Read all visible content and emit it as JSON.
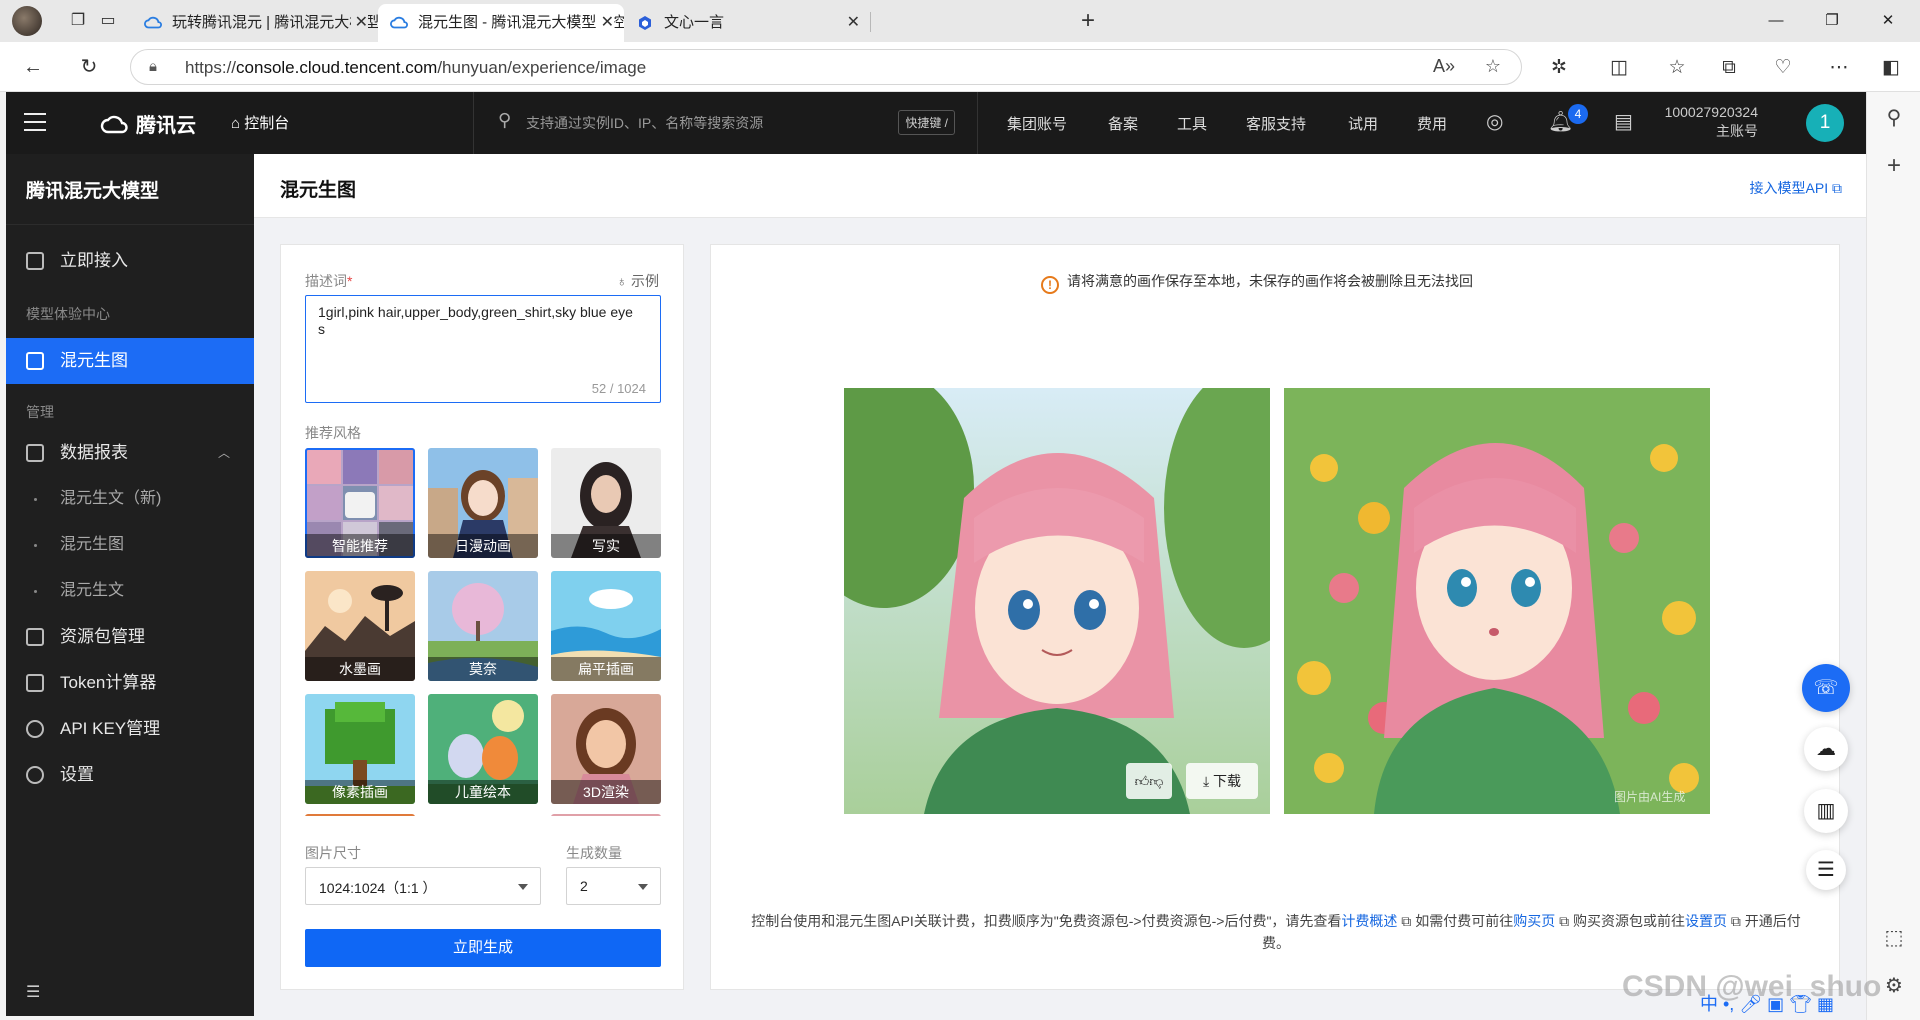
{
  "browser": {
    "tabs": [
      {
        "title": "玩转腾讯混元 | 腾讯混元大模型AI",
        "active": false
      },
      {
        "title": "混元生图 - 腾讯混元大模型 - 控制",
        "active": true
      },
      {
        "title": "文心一言",
        "active": false
      }
    ],
    "url_prefix": "https://",
    "url_domain": "console.cloud.tencent.com",
    "url_path": "/hunyuan/experience/image"
  },
  "topbar": {
    "brand": "腾讯云",
    "console": "控制台",
    "search_placeholder": "支持通过实例ID、IP、名称等搜索资源",
    "shortcut": "快捷键 /",
    "nav": [
      "集团账号",
      "备案",
      "工具",
      "客服支持",
      "试用",
      "费用"
    ],
    "notification_count": "4",
    "account_id": "100027920324",
    "account_role": "主账号",
    "avatar_initial": "1"
  },
  "sidebar": {
    "product": "腾讯混元大模型",
    "quick_access": "立即接入",
    "group_experience": "模型体验中心",
    "image_gen": "混元生图",
    "group_manage": "管理",
    "data_report": "数据报表",
    "sub_items": [
      "混元生文（新)",
      "混元生图",
      "混元生文"
    ],
    "resource_pkg": "资源包管理",
    "token_calc": "Token计算器",
    "api_key": "API KEY管理",
    "settings": "设置"
  },
  "page": {
    "title": "混元生图",
    "api_link": "接入模型API"
  },
  "form": {
    "prompt_label": "描述词",
    "required_mark": "*",
    "example_label": "示例",
    "prompt_value": "1girl,pink hair,upper_body,green_shirt,sky blue eyes",
    "char_count": "52 / 1024",
    "style_label": "推荐风格",
    "styles": [
      "智能推荐",
      "日漫动画",
      "写实",
      "水墨画",
      "莫奈",
      "扁平插画",
      "像素插画",
      "儿童绘本",
      "3D渲染"
    ],
    "selected_style": "智能推荐",
    "size_label": "图片尺寸",
    "size_value": "1024:1024（1:1 ）",
    "count_label": "生成数量",
    "count_value": "2",
    "generate_button": "立即生成"
  },
  "result": {
    "warning": "请将满意的画作保存至本地，未保存的画作将会被删除且无法找回",
    "download": "下载",
    "watermark": "图片由AI生成",
    "billing_text_1": "控制台使用和混元生图API关联计费，扣费顺序为\"免费资源包->付费资源包->后付费\"，请先查看",
    "billing_link_1": "计费概述",
    "billing_text_2": "如需付费可前往",
    "billing_link_2": "购买页",
    "billing_text_3": "购买资源包或前往",
    "billing_link_3": "设置页",
    "billing_text_4": "开通后付费。"
  },
  "overlay": {
    "csdn_watermark": "CSDN @wei_shuo",
    "ime": "中"
  },
  "colors": {
    "accent": "#1c6cf5",
    "topbar_bg": "#1a1a1a",
    "sidebar_bg": "#1f1f1f",
    "warning": "#e67a1b"
  }
}
